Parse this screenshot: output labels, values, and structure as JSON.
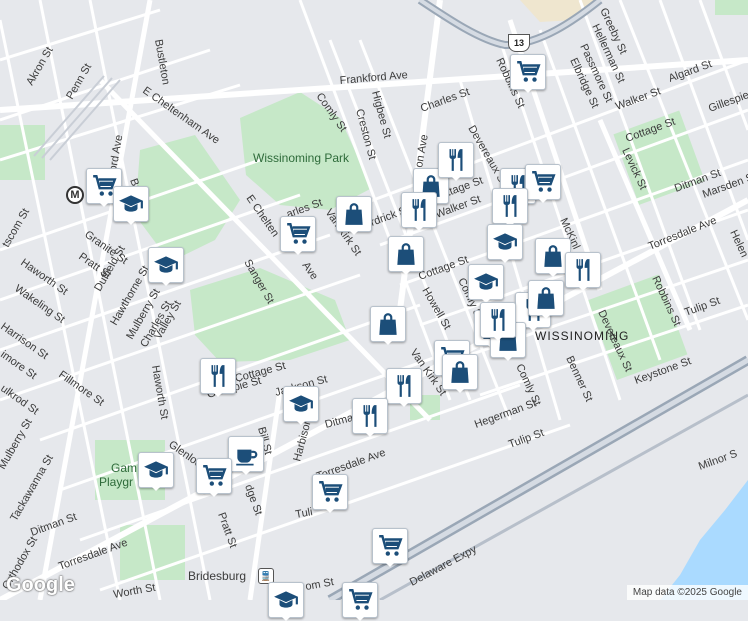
{
  "map": {
    "area_labels": {
      "park": "Wissinoming Park",
      "neighborhood": "WISSINOMING",
      "playground_line1": "Gam",
      "playground_line2": "Playgr",
      "bridesburg": "Bridesburg"
    },
    "street_labels": {
      "bustleton": "Bustleton",
      "frankford_ave": "Frankford Ave",
      "akron": "Akron St",
      "penn": "Penn St",
      "e_cheltenham_1": "E Cheltenham Ave",
      "e_cheltenham_2": "E Chelten",
      "ave": "Ave",
      "comly_1": "Comly St",
      "higbee": "Higbee St",
      "creston": "Creston St",
      "charles_1": "Charles St",
      "devereaux_1": "Devereaux St",
      "greeby": "Greeby St",
      "hellerman_1": "Hellerman St",
      "passmore": "Passmore St",
      "elbridge": "Elbridge St",
      "robbins_1": "Robbins St",
      "algard": "Algard St",
      "walker_1": "Walker St",
      "gillespie_1": "Gillespie St",
      "cottage_1": "Cottage St",
      "levick": "Levick St",
      "ditman_1": "Ditman St",
      "marsden": "Marsden St",
      "torresdale_1": "Torresdale Ave",
      "helen": "Helen",
      "mckinley": "McKinl",
      "tulip_1": "Tulip St",
      "robbins_2": "Robbins St",
      "devereaux_2": "Devereaux St",
      "keystone": "Keystone St",
      "benner": "Benner St",
      "comly_2": "Comly St",
      "comly_3": "Comly St",
      "hegerman": "Hegerman St",
      "tulip_2": "Tulip St",
      "van_kirk_1": "Van Kirk St",
      "van_kirk_2": "Van Kirk St",
      "howell": "Howell St",
      "cottage_2": "Cottage St",
      "walker_2": "Walker St",
      "frankford_short": "rdrick S",
      "cottage_3": "ttage St",
      "wissinoming_st": "on Ave",
      "charles_2": "arles St",
      "sanger": "Sanger St",
      "duffield": "Duffield St",
      "hawthorne": "Hawthorne St",
      "mulberry_1": "Mulberry St",
      "charles_3": "Charles St",
      "valley": "Valley St",
      "haworth_1": "Haworth St",
      "wakeling": "Wakeling St",
      "harrison": "Harrison St",
      "imore": "imore St",
      "ulkrod": "ulkrod St",
      "fillmore": "Fillmore St",
      "haworth_2": "Haworth St",
      "granite": "Granite St",
      "pratt_1": "Pratt St",
      "scom": "tscom St",
      "cottage_4": "Cottage St",
      "gillespie_2": "Gillespie St",
      "jackson": "Jackson St",
      "harbison": "Harbison Ave",
      "ditman_2": "Ditman St",
      "glenloch": "Glenloch St",
      "bill": "Bill St",
      "mulberry_2": "Mulberry St",
      "tackawanna": "Tackawanna St",
      "ditman_3": "Ditman St",
      "torresdale_2": "Torresdale Ave",
      "torresdale_3": "Torresdale Ave",
      "orthodox": "Orthodox St",
      "pratt_2": "Pratt St",
      "ridge": "dge St",
      "worth": "Worth St",
      "om": "om St",
      "tulip_3": "Tuli",
      "delaware_expy": "Delaware Expy",
      "milnor": "Milnor S",
      "ord_ave": "ord Ave",
      "bri": "Bri"
    },
    "route_shield": "13",
    "metro_badge": "M"
  },
  "pois": [
    {
      "type": "grocery",
      "icon": "shopping-cart-icon"
    },
    {
      "type": "grocery",
      "icon": "shopping-cart-icon"
    },
    {
      "type": "school",
      "icon": "graduation-cap-icon"
    },
    {
      "type": "school",
      "icon": "graduation-cap-icon"
    },
    {
      "type": "grocery",
      "icon": "shopping-cart-icon"
    },
    {
      "type": "shopping",
      "icon": "shopping-bag-icon"
    },
    {
      "type": "shopping",
      "icon": "shopping-bag-icon"
    },
    {
      "type": "shopping",
      "icon": "shopping-bag-icon"
    },
    {
      "type": "restaurant",
      "icon": "fork-knife-icon"
    },
    {
      "type": "restaurant",
      "icon": "fork-knife-icon"
    },
    {
      "type": "shopping",
      "icon": "shopping-bag-icon"
    },
    {
      "type": "restaurant",
      "icon": "fork-knife-icon"
    },
    {
      "type": "grocery",
      "icon": "shopping-cart-icon"
    },
    {
      "type": "restaurant",
      "icon": "fork-knife-icon"
    },
    {
      "type": "school",
      "icon": "graduation-cap-icon"
    },
    {
      "type": "shopping",
      "icon": "shopping-bag-icon"
    },
    {
      "type": "restaurant",
      "icon": "fork-knife-icon"
    },
    {
      "type": "school",
      "icon": "graduation-cap-icon"
    },
    {
      "type": "restaurant",
      "icon": "fork-knife-icon"
    },
    {
      "type": "shopping",
      "icon": "shopping-bag-icon"
    },
    {
      "type": "shopping",
      "icon": "shopping-bag-icon"
    },
    {
      "type": "shopping",
      "icon": "shopping-bag-icon"
    },
    {
      "type": "restaurant",
      "icon": "fork-knife-icon"
    },
    {
      "type": "restaurant",
      "icon": "fork-knife-icon"
    },
    {
      "type": "restaurant",
      "icon": "fork-knife-icon"
    },
    {
      "type": "school",
      "icon": "graduation-cap-icon"
    },
    {
      "type": "cafe",
      "icon": "coffee-cup-icon"
    },
    {
      "type": "school",
      "icon": "graduation-cap-icon"
    },
    {
      "type": "grocery",
      "icon": "shopping-cart-icon"
    },
    {
      "type": "grocery",
      "icon": "shopping-cart-icon"
    },
    {
      "type": "grocery",
      "icon": "shopping-cart-icon"
    },
    {
      "type": "school",
      "icon": "graduation-cap-icon"
    },
    {
      "type": "grocery",
      "icon": "shopping-cart-icon"
    },
    {
      "type": "restaurant",
      "icon": "fork-knife-icon"
    },
    {
      "type": "grocery",
      "icon": "shopping-cart-icon"
    },
    {
      "type": "shopping",
      "icon": "shopping-bag-icon"
    }
  ],
  "footer": {
    "logo": "Google",
    "attribution": "Map data ©2025 Google"
  },
  "colors": {
    "poi_icon": "#1c4e79",
    "park": "#c6e8c8",
    "water": "#aadaff",
    "highway": "#9aa7b6",
    "road": "#ffffff",
    "land": "#e6e8ec"
  }
}
